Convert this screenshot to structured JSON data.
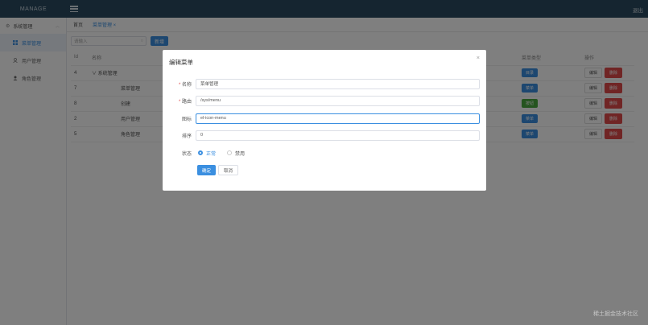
{
  "header": {
    "brand": "MANAGE",
    "logout": "退出"
  },
  "sidebar": {
    "group": "系统管理",
    "items": [
      {
        "label": "菜单管理",
        "icon": "grid-icon",
        "active": true
      },
      {
        "label": "用户管理",
        "icon": "user-outline-icon"
      },
      {
        "label": "角色管理",
        "icon": "person-icon"
      }
    ]
  },
  "tabs": [
    {
      "label": "首页"
    },
    {
      "label": "菜单管理 ×"
    }
  ],
  "toolbar": {
    "search_placeholder": "请输入",
    "add_label": "新增"
  },
  "table": {
    "columns": [
      "Id",
      "名称",
      "菜单类型",
      "操作"
    ],
    "rows": [
      {
        "id": "4",
        "name": "∨ 系统管理",
        "type": "目录",
        "type_color": "blue"
      },
      {
        "id": "7",
        "name": "菜单管理",
        "type": "菜单",
        "type_color": "blue"
      },
      {
        "id": "8",
        "name": "创建",
        "type": "按钮",
        "type_color": "green"
      },
      {
        "id": "2",
        "name": "用户管理",
        "type": "菜单",
        "type_color": "blue"
      },
      {
        "id": "5",
        "name": "角色管理",
        "type": "菜单",
        "type_color": "blue"
      }
    ],
    "ops": {
      "edit": "编辑",
      "delete": "删除"
    }
  },
  "dialog": {
    "title": "编辑菜单",
    "close": "×",
    "fields": [
      {
        "label": "名称",
        "required": true,
        "value": "菜单管理"
      },
      {
        "label": "路由",
        "required": true,
        "value": "/sys/menu"
      },
      {
        "label": "图标",
        "required": false,
        "value": "el-icon-menu"
      },
      {
        "label": "排序",
        "required": false,
        "value": "0"
      }
    ],
    "status": {
      "label": "状态",
      "options": [
        "正常",
        "禁用"
      ],
      "selected": "正常"
    },
    "ok": "确定",
    "cancel": "取消"
  },
  "watermark": "稀土掘金技术社区",
  "colors": {
    "topbar": "#2b4a60",
    "accent": "#3b8fe0",
    "danger": "#e04a4a",
    "success": "#4aa83f"
  }
}
